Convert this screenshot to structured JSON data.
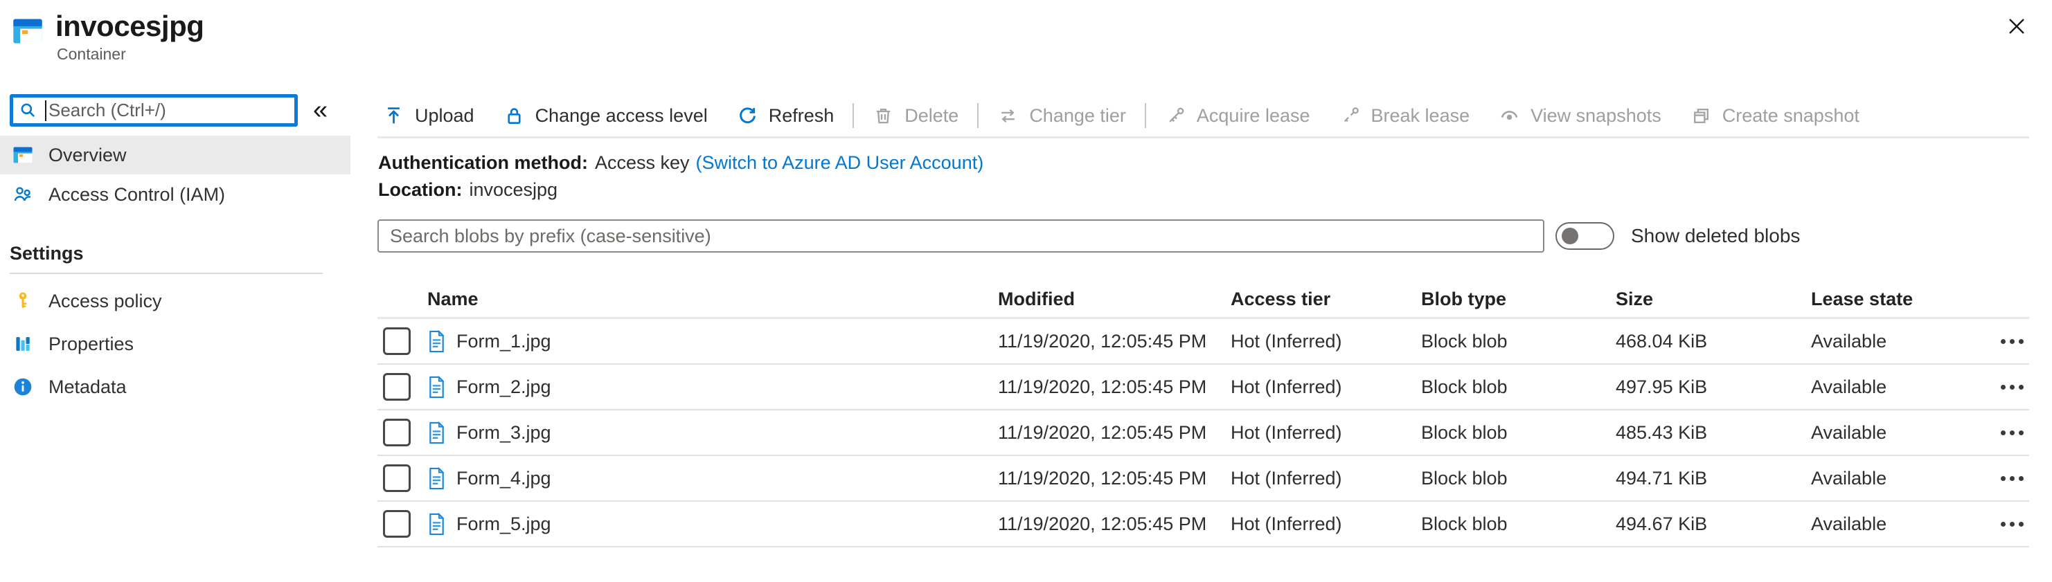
{
  "header": {
    "title": "invocesjpg",
    "subtitle": "Container",
    "close_icon": "✕"
  },
  "sidebar": {
    "search_placeholder": "Search (Ctrl+/)",
    "collapse_icon": "«",
    "items": [
      {
        "label": "Overview",
        "icon": "container-icon",
        "selected": true
      },
      {
        "label": "Access Control (IAM)",
        "icon": "people-icon",
        "selected": false
      }
    ],
    "section_label": "Settings",
    "settings_items": [
      {
        "label": "Access policy",
        "icon": "key-icon"
      },
      {
        "label": "Properties",
        "icon": "bars-icon"
      },
      {
        "label": "Metadata",
        "icon": "info-icon"
      }
    ]
  },
  "toolbar": {
    "buttons": [
      {
        "label": "Upload",
        "icon": "upload-icon",
        "enabled": true
      },
      {
        "label": "Change access level",
        "icon": "lock-icon",
        "enabled": true
      },
      {
        "label": "Refresh",
        "icon": "refresh-icon",
        "enabled": true
      },
      {
        "label": "Delete",
        "icon": "trash-icon",
        "enabled": false
      },
      {
        "label": "Change tier",
        "icon": "change-tier-icon",
        "enabled": false
      },
      {
        "label": "Acquire lease",
        "icon": "lease-icon",
        "enabled": false
      },
      {
        "label": "Break lease",
        "icon": "break-lease-icon",
        "enabled": false
      },
      {
        "label": "View snapshots",
        "icon": "snapshots-icon",
        "enabled": false
      },
      {
        "label": "Create snapshot",
        "icon": "create-snapshot-icon",
        "enabled": false
      }
    ]
  },
  "info": {
    "auth_label": "Authentication method:",
    "auth_value": "Access key",
    "auth_link": "(Switch to Azure AD User Account)",
    "location_label": "Location:",
    "location_value": "invocesjpg"
  },
  "filter": {
    "search_placeholder": "Search blobs by prefix (case-sensitive)",
    "toggle_label": "Show deleted blobs",
    "toggle_on": false
  },
  "table": {
    "columns": [
      "Name",
      "Modified",
      "Access tier",
      "Blob type",
      "Size",
      "Lease state"
    ],
    "rows": [
      {
        "name": "Form_1.jpg",
        "modified": "11/19/2020, 12:05:45 PM",
        "access_tier": "Hot (Inferred)",
        "blob_type": "Block blob",
        "size": "468.04 KiB",
        "lease_state": "Available"
      },
      {
        "name": "Form_2.jpg",
        "modified": "11/19/2020, 12:05:45 PM",
        "access_tier": "Hot (Inferred)",
        "blob_type": "Block blob",
        "size": "497.95 KiB",
        "lease_state": "Available"
      },
      {
        "name": "Form_3.jpg",
        "modified": "11/19/2020, 12:05:45 PM",
        "access_tier": "Hot (Inferred)",
        "blob_type": "Block blob",
        "size": "485.43 KiB",
        "lease_state": "Available"
      },
      {
        "name": "Form_4.jpg",
        "modified": "11/19/2020, 12:05:45 PM",
        "access_tier": "Hot (Inferred)",
        "blob_type": "Block blob",
        "size": "494.71 KiB",
        "lease_state": "Available"
      },
      {
        "name": "Form_5.jpg",
        "modified": "11/19/2020, 12:05:45 PM",
        "access_tier": "Hot (Inferred)",
        "blob_type": "Block blob",
        "size": "494.67 KiB",
        "lease_state": "Available"
      }
    ]
  },
  "colors": {
    "accent": "#0078d4",
    "disabled": "#a19f9d",
    "text": "#323130",
    "text_secondary": "#605e5c",
    "selected_bg": "#eaeaea"
  }
}
